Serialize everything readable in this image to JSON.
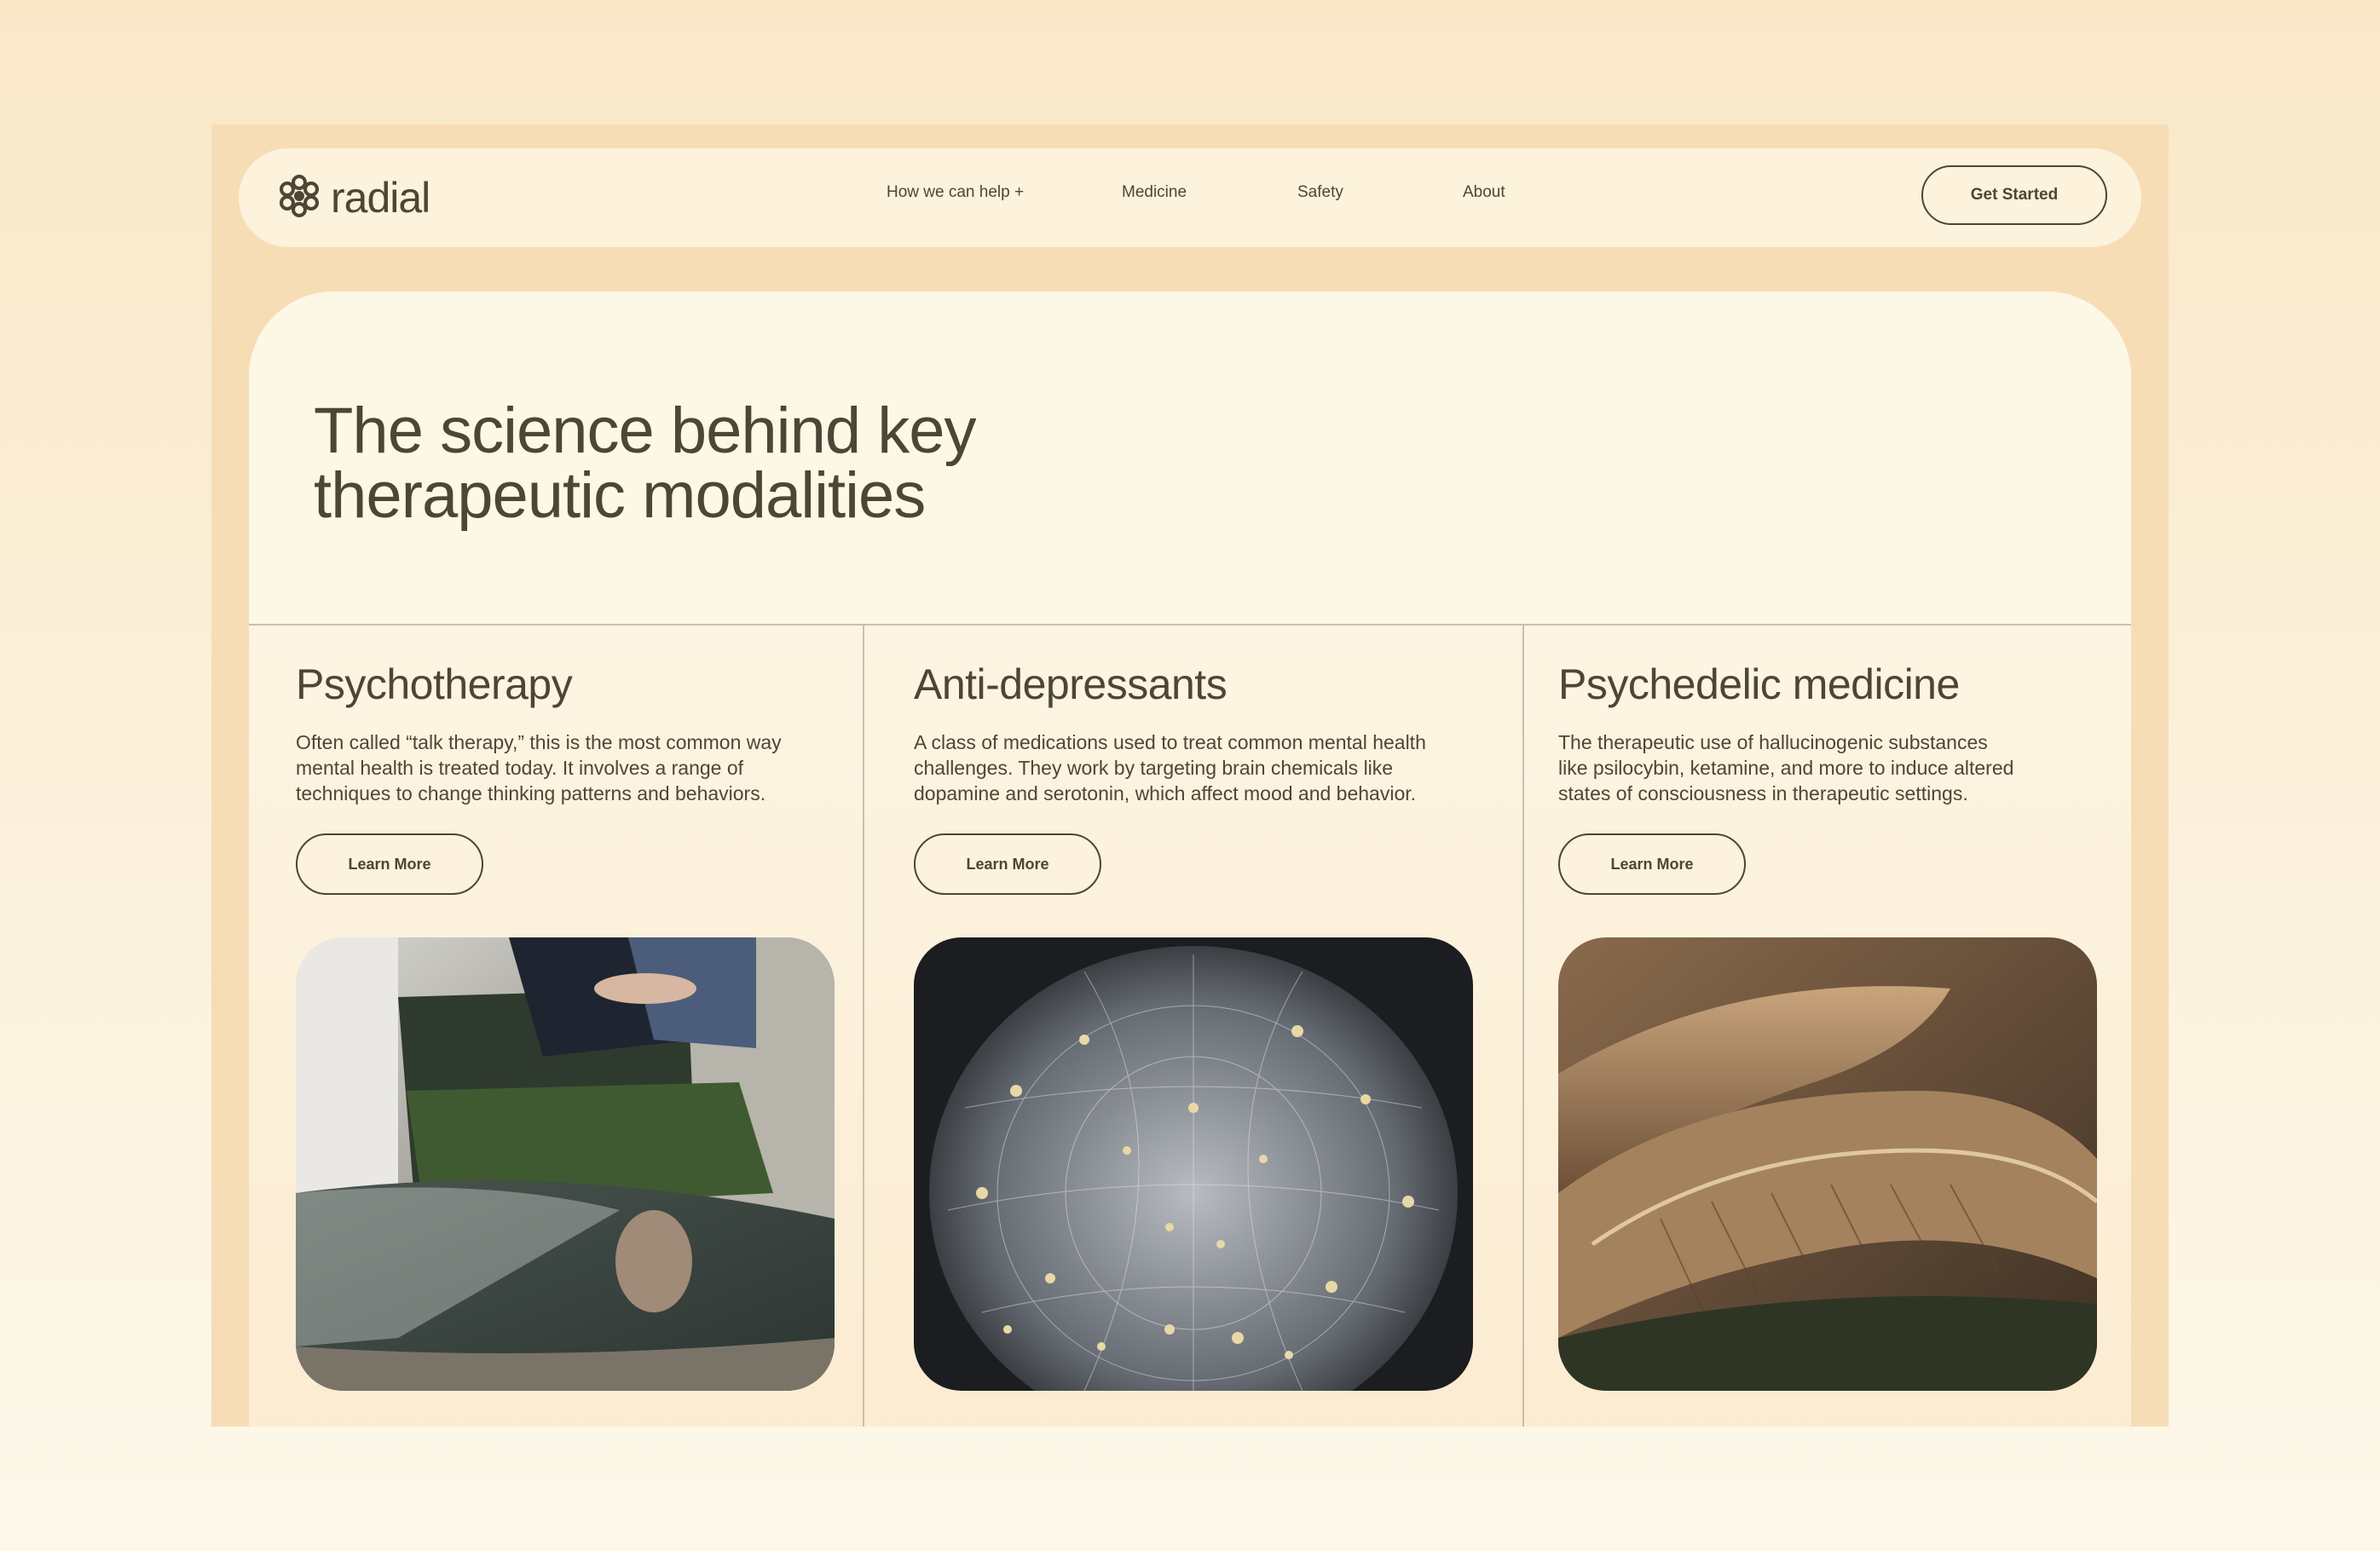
{
  "brand": {
    "name": "radial",
    "logo_icon": "radial-flower-icon"
  },
  "nav": {
    "links": [
      "How we can help +",
      "Medicine",
      "Safety",
      "About"
    ],
    "cta": "Get Started"
  },
  "hero": {
    "title": "The science behind key\ntherapeutic modalities"
  },
  "cards": [
    {
      "title": "Psychotherapy",
      "description": "Often called “talk therapy,” this is the most common way\nmental health is treated today. It involves a range of\ntechniques to change thinking patterns and behaviors.",
      "button": "Learn More",
      "image_subject": "person seated in green armchair reflected in glass table"
    },
    {
      "title": "Anti-depressants",
      "description": "A class of medications used to treat common mental health\nchallenges. They work by targeting brain chemicals like\ndopamine and serotonin, which affect mood and behavior.",
      "button": "Learn More",
      "image_subject": "glass wireframe brain with golden spheres"
    },
    {
      "title": "Psychedelic medicine",
      "description": "The therapeutic use of hallucinogenic substances\nlike psilocybin, ketamine, and more to induce altered\nstates of consciousness in therapeutic settings.",
      "button": "Learn More",
      "image_subject": "close-up of mushroom gills"
    }
  ],
  "colors": {
    "page_bg": "#f9e8c8",
    "frame": "#f7ddb6",
    "nav_bg": "#fdf2db",
    "panel_bg": "#fdf7e6",
    "text": "#4d4636",
    "divider": "#c9bfae"
  }
}
